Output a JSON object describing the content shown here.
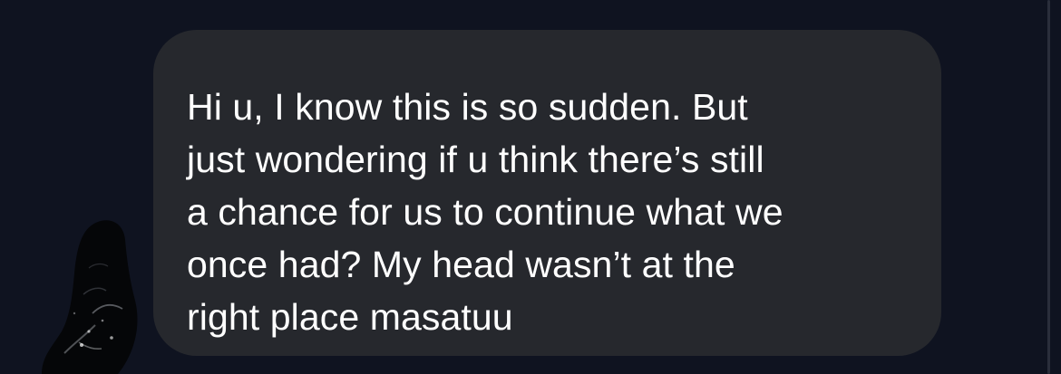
{
  "conversation": {
    "incoming_message": {
      "text": "Hi u, I know this is so sudden. But\njust wondering if u think there’s still\na chance for us to continue what we\nonce had? My head wasn’t at the\nright place masatuu"
    }
  },
  "colors": {
    "background": "#0f1320",
    "bubble": "#26282d",
    "text": "#ffffff"
  },
  "icons": {
    "avatar": "avatar-icon"
  }
}
